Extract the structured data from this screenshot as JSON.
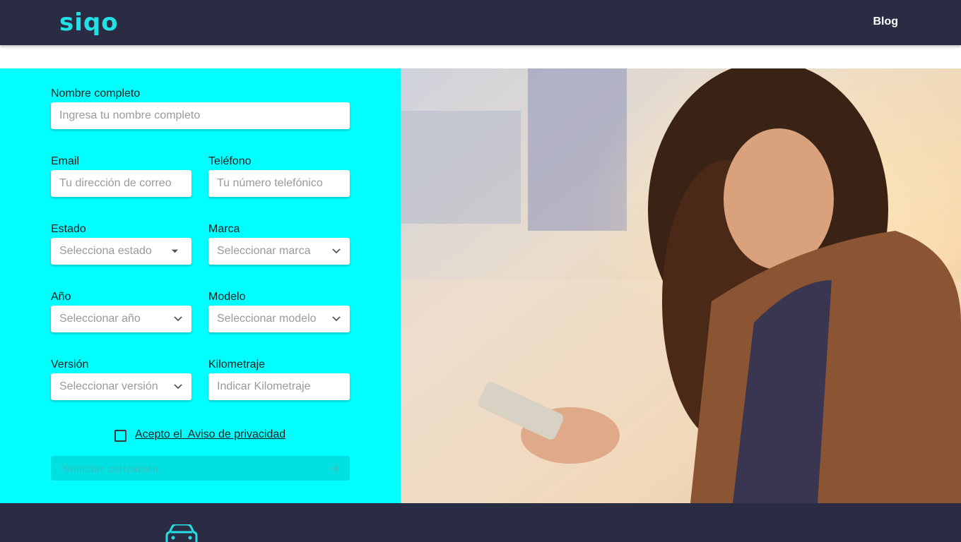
{
  "brand": {
    "logo_text": "siqo",
    "accent": "#22e0e6",
    "header_bg": "#2a2c44"
  },
  "nav": {
    "blog_label": "Blog"
  },
  "form": {
    "panel_bg": "#00ffff",
    "nombre": {
      "label": "Nombre completo",
      "placeholder": "Ingresa tu nombre completo"
    },
    "email": {
      "label": "Email",
      "placeholder": "Tu dirección de correo"
    },
    "telefono": {
      "label": "Teléfono",
      "placeholder": "Tu número telefónico"
    },
    "estado": {
      "label": "Estado",
      "selected": "Selecciona estado",
      "icon": "caret-down-icon"
    },
    "marca": {
      "label": "Marca",
      "selected": "Seleccionar marca",
      "icon": "chevron-down-icon"
    },
    "anio": {
      "label": "Año",
      "selected": "Seleccionar año",
      "icon": "chevron-down-icon"
    },
    "modelo": {
      "label": "Modelo",
      "selected": "Seleccionar modelo",
      "icon": "chevron-down-icon"
    },
    "version": {
      "label": "Versión",
      "selected": "Seleccionar versión",
      "icon": "chevron-down-icon"
    },
    "kilometraje": {
      "label": "Kilometraje",
      "placeholder": "Indicar Kilometraje"
    },
    "consent_label": "Acepto el  Aviso de privacidad",
    "submit_label": "Solicitar cotización"
  },
  "hero_image": {
    "subject": "woman-looking-at-phone-photo"
  },
  "footer": {
    "icon": "car-icon"
  }
}
